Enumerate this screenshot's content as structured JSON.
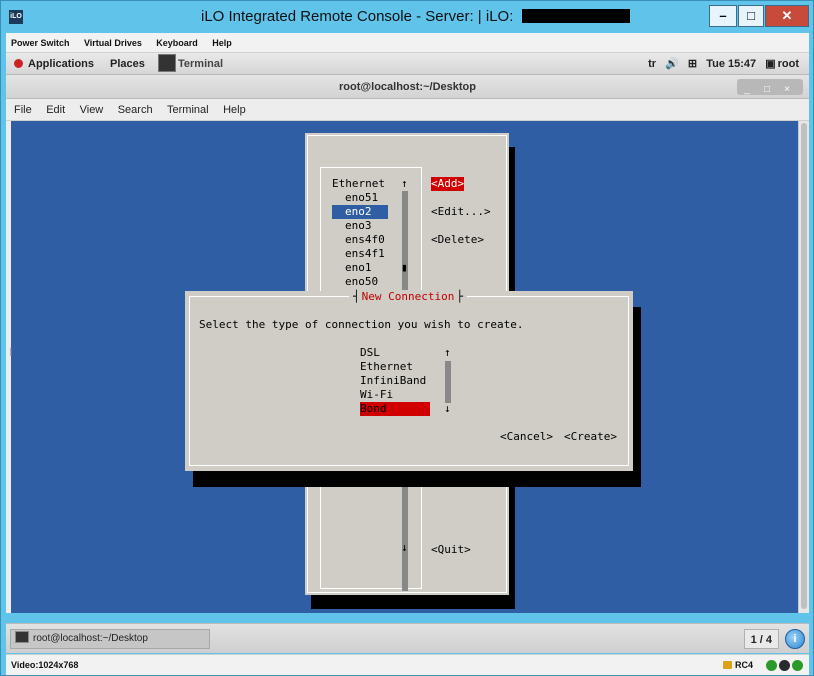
{
  "ilo_window": {
    "app_icon": "iLO",
    "title": "iLO Integrated Remote Console - Server:  | iLO: ",
    "buttons": {
      "minimize": "–",
      "maximize": "□",
      "close": "✕"
    }
  },
  "ilo_menu": [
    "Power Switch",
    "Virtual Drives",
    "Keyboard",
    "Help"
  ],
  "gnome_topbar": {
    "applications": "Applications",
    "places": "Places",
    "terminal_task": "Terminal",
    "tray": {
      "keyboard_layout": "tr",
      "volume_icon": "🔊",
      "network_icon": "⊞",
      "clock": "Tue 15:47",
      "user_icon": "▣",
      "user": "root"
    }
  },
  "terminal_window": {
    "title": "root@localhost:~/Desktop",
    "window_buttons": {
      "minimize": "_",
      "maximize": "□",
      "close": "×"
    },
    "menu": [
      "File",
      "Edit",
      "View",
      "Search",
      "Terminal",
      "Help"
    ]
  },
  "nmtui": {
    "list_header": "Ethernet",
    "scroll_up": "↑",
    "scroll_down": "↓",
    "scroll_thumb": "▮",
    "connections": [
      "eno51",
      "eno2",
      "eno3",
      "ens4f0",
      "ens4f1",
      "eno1",
      "eno50"
    ],
    "selected_connection": "eno2",
    "buttons": {
      "add": "<Add>",
      "edit": "<Edit...>",
      "delete": "<Delete>",
      "quit": "<Quit>"
    }
  },
  "dialog": {
    "title": "New Connection",
    "prompt": "Select the type of connection you wish to create.",
    "types": [
      "DSL",
      "Ethernet",
      "InfiniBand",
      "Wi-Fi",
      "Bond"
    ],
    "selected_type": "Bond",
    "scroll_up": "↑",
    "scroll_down": "↓",
    "cancel": "<Cancel>",
    "create": "<Create>"
  },
  "taskbar": {
    "task_label": "root@localhost:~/Desktop",
    "workspace": "1 / 4",
    "workspace_icon": "i"
  },
  "ilo_status": {
    "video": "Video:1024x768",
    "encryption": "RC4"
  },
  "colors": {
    "terminal_bg": "#2f5ea4",
    "tui_panel": "#cfcdc6",
    "highlight_red": "#d00000",
    "title_red": "#c00000",
    "ilo_titlebar": "#5fc3ea"
  }
}
